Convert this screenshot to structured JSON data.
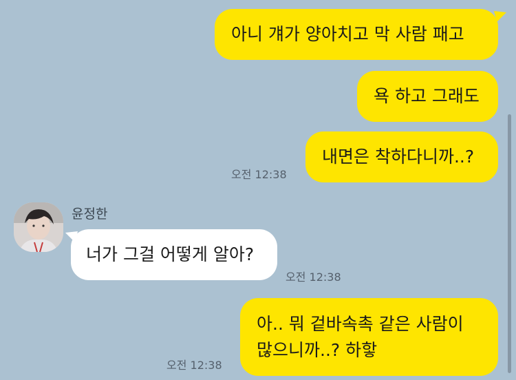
{
  "messages": [
    {
      "side": "me",
      "text": "아니 걔가 양아치고 막 사람 패고"
    },
    {
      "side": "me",
      "text": "욕 하고 그래도"
    },
    {
      "side": "me",
      "text": "내면은 착하다니까..?",
      "time": "오전 12:38"
    },
    {
      "side": "other",
      "sender": "윤정한",
      "text": "너가 그걸 어떻게 알아?",
      "time": "오전 12:38"
    },
    {
      "side": "me",
      "line1": "아.. 뭐 겉바속촉 같은 사람이",
      "line2": "많으니까..? 하핳",
      "time": "오전 12:38"
    }
  ],
  "colors": {
    "background": "#abc1d1",
    "my_bubble": "#fee500",
    "other_bubble": "#ffffff"
  },
  "icons": {
    "avatar": "profile-photo"
  }
}
